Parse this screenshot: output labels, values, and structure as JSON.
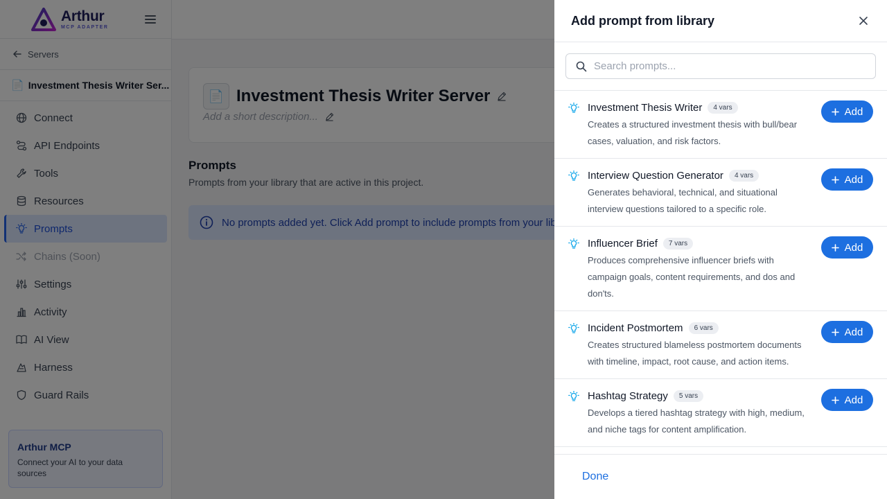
{
  "brand": {
    "name": "Arthur",
    "subtitle": "MCP ADAPTER"
  },
  "sidebar": {
    "back_label": "Servers",
    "server_name": "Investment Thesis Writer Ser...",
    "items": [
      {
        "label": "Connect",
        "icon": "globe-icon"
      },
      {
        "label": "API Endpoints",
        "icon": "route-icon"
      },
      {
        "label": "Tools",
        "icon": "wrench-icon"
      },
      {
        "label": "Resources",
        "icon": "database-icon"
      },
      {
        "label": "Prompts",
        "icon": "bulb-icon",
        "active": true
      },
      {
        "label": "Chains (Soon)",
        "icon": "shuffle-icon",
        "disabled": true
      },
      {
        "label": "Settings",
        "icon": "sliders-icon"
      },
      {
        "label": "Activity",
        "icon": "bar-chart-icon"
      },
      {
        "label": "AI View",
        "icon": "book-icon"
      },
      {
        "label": "Harness",
        "icon": "harness-icon"
      },
      {
        "label": "Guard Rails",
        "icon": "shield-icon"
      }
    ],
    "promo": {
      "title": "Arthur MCP",
      "text": "Connect your AI to your data sources"
    }
  },
  "main": {
    "title": "Investment Thesis Writer Server",
    "description_placeholder": "Add a short description...",
    "section_title": "Prompts",
    "section_sub": "Prompts from your library that are active in this project.",
    "info": "No prompts added yet. Click Add prompt to include prompts from your library."
  },
  "drawer": {
    "title": "Add prompt from library",
    "search_placeholder": "Search prompts...",
    "add_label": "Add",
    "done_label": "Done",
    "items": [
      {
        "title": "Investment Thesis Writer",
        "vars": "4 vars",
        "desc": "Creates a structured investment thesis with bull/bear cases, valuation, and risk factors."
      },
      {
        "title": "Interview Question Generator",
        "vars": "4 vars",
        "desc": "Generates behavioral, technical, and situational interview questions tailored to a specific role."
      },
      {
        "title": "Influencer Brief",
        "vars": "7 vars",
        "desc": "Produces comprehensive influencer briefs with campaign goals, content requirements, and dos and don'ts."
      },
      {
        "title": "Incident Postmortem",
        "vars": "6 vars",
        "desc": "Creates structured blameless postmortem documents with timeline, impact, root cause, and action items."
      },
      {
        "title": "Hashtag Strategy",
        "vars": "5 vars",
        "desc": "Develops a tiered hashtag strategy with high, medium, and niche tags for content amplification."
      }
    ]
  },
  "colors": {
    "accent": "#1d6fe0",
    "bulb": "#0ea5e9",
    "active_bg": "#dbe7ff"
  }
}
